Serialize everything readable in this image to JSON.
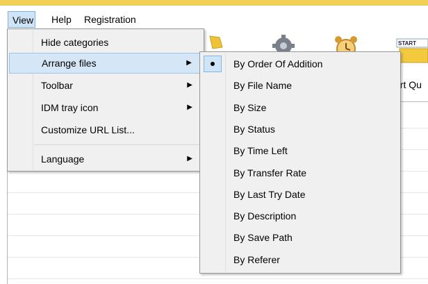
{
  "menubar": {
    "items": [
      {
        "label": "View"
      },
      {
        "label": "Help"
      },
      {
        "label": "Registration"
      }
    ]
  },
  "toolbar": {
    "partial_label": "art Qu"
  },
  "view_menu": {
    "items": [
      {
        "label": "Hide categories",
        "submenu": false
      },
      {
        "label": "Arrange files",
        "submenu": true,
        "highlighted": true
      },
      {
        "label": "Toolbar",
        "submenu": true
      },
      {
        "label": "IDM tray icon",
        "submenu": true
      },
      {
        "label": "Customize URL List...",
        "submenu": false
      },
      {
        "label": "Language",
        "submenu": true
      }
    ],
    "arrow_glyph": "▶"
  },
  "arrange_menu": {
    "items": [
      {
        "label": "By Order Of Addition",
        "checked": true
      },
      {
        "label": "By File Name"
      },
      {
        "label": "By Size"
      },
      {
        "label": "By Status"
      },
      {
        "label": "By Time Left"
      },
      {
        "label": "By Transfer Rate"
      },
      {
        "label": "By Last Try Date"
      },
      {
        "label": "By Description"
      },
      {
        "label": "By Save Path"
      },
      {
        "label": "By Referer"
      }
    ]
  },
  "colors": {
    "accent_yellow": "#f3cf58",
    "selection": "#d5e6f6",
    "menu_bg": "#f0f0f0"
  }
}
